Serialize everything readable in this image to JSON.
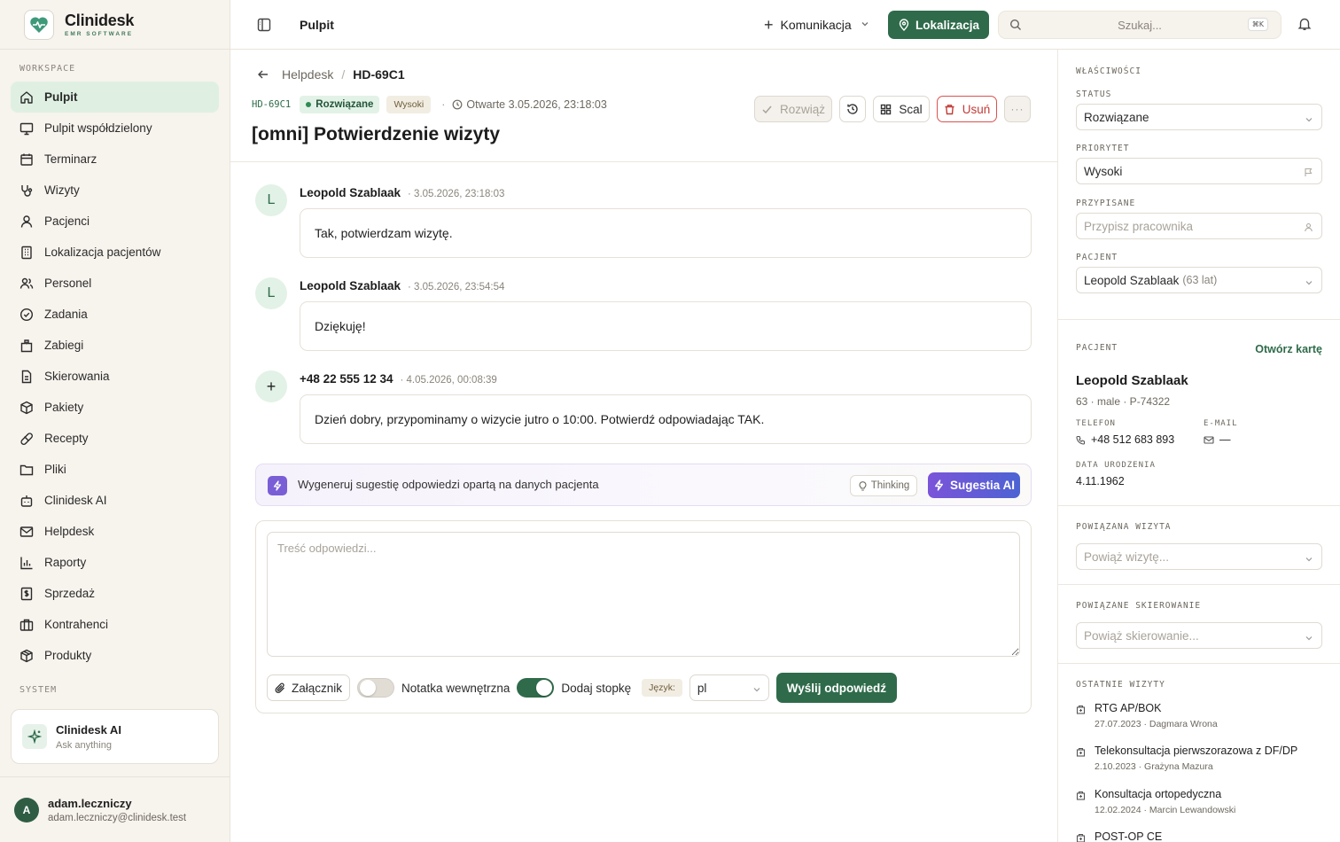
{
  "brand": {
    "name": "Clinidesk",
    "subtitle": "EMR SOFTWARE"
  },
  "sidebar": {
    "workspace_label": "WORKSPACE",
    "system_label": "SYSTEM",
    "items": [
      {
        "label": "Pulpit",
        "icon": "home-icon",
        "active": true
      },
      {
        "label": "Pulpit współdzielony",
        "icon": "monitor-icon"
      },
      {
        "label": "Terminarz",
        "icon": "calendar-icon"
      },
      {
        "label": "Wizyty",
        "icon": "stethoscope-icon"
      },
      {
        "label": "Pacjenci",
        "icon": "user-icon"
      },
      {
        "label": "Lokalizacja pacjentów",
        "icon": "building-icon"
      },
      {
        "label": "Personel",
        "icon": "users-icon"
      },
      {
        "label": "Zadania",
        "icon": "check-circle-icon"
      },
      {
        "label": "Zabiegi",
        "icon": "hospital-icon"
      },
      {
        "label": "Skierowania",
        "icon": "document-icon"
      },
      {
        "label": "Pakiety",
        "icon": "package-icon"
      },
      {
        "label": "Recepty",
        "icon": "pill-icon"
      },
      {
        "label": "Pliki",
        "icon": "folder-icon"
      },
      {
        "label": "Clinidesk AI",
        "icon": "bot-icon"
      },
      {
        "label": "Helpdesk",
        "icon": "mail-icon"
      },
      {
        "label": "Raporty",
        "icon": "bar-chart-icon"
      },
      {
        "label": "Sprzedaż",
        "icon": "receipt-icon"
      },
      {
        "label": "Kontrahenci",
        "icon": "briefcase-icon"
      },
      {
        "label": "Produkty",
        "icon": "box-icon"
      }
    ],
    "ai_card": {
      "title": "Clinidesk AI",
      "subtitle": "Ask anything"
    },
    "user": {
      "initial": "A",
      "name": "adam.leczniczy",
      "email": "adam.leczniczy@clinidesk.test"
    }
  },
  "topbar": {
    "title": "Pulpit",
    "komunikacja": "Komunikacja",
    "lokalizacja": "Lokalizacja",
    "search_placeholder": "Szukaj...",
    "search_shortcut": "⌘K"
  },
  "ticket": {
    "breadcrumb_parent": "Helpdesk",
    "breadcrumb_sep": "/",
    "breadcrumb_current": "HD-69C1",
    "id": "HD-69C1",
    "status": "Rozwiązane",
    "priority": "Wysoki",
    "meta_sep": "·",
    "opened": "Otwarte 3.05.2026, 23:18:03",
    "title": "[omni] Potwierdzenie wizyty",
    "actions": {
      "resolve": "Rozwiąż",
      "merge": "Scal",
      "delete": "Usuń",
      "more": "···"
    }
  },
  "messages": [
    {
      "initial": "L",
      "author": "Leopold Szablaak",
      "time": "· 3.05.2026, 23:18:03",
      "text": "Tak, potwierdzam wizytę."
    },
    {
      "initial": "L",
      "author": "Leopold Szablaak",
      "time": "· 3.05.2026, 23:54:54",
      "text": "Dziękuję!"
    },
    {
      "initial": "+",
      "author": "+48 22 555 12 34",
      "time": "· 4.05.2026, 00:08:39",
      "text": "Dzień dobry, przypominamy o wizycie jutro o 10:00. Potwierdź odpowiadając TAK."
    }
  ],
  "ai_suggest": {
    "text": "Wygeneruj sugestię odpowiedzi opartą na danych pacjenta",
    "thinking": "Thinking",
    "button": "Sugestia AI"
  },
  "composer": {
    "placeholder": "Treść odpowiedzi...",
    "attach": "Załącznik",
    "internal_note": "Notatka wewnętrzna",
    "internal_note_on": false,
    "footer": "Dodaj stopkę",
    "footer_on": true,
    "lang_label": "Język:",
    "lang_value": "pl",
    "send": "Wyślij odpowiedź"
  },
  "properties": {
    "title": "WŁAŚCIWOŚCI",
    "status_label": "STATUS",
    "status_value": "Rozwiązane",
    "priority_label": "PRIORYTET",
    "priority_value": "Wysoki",
    "assigned_label": "PRZYPISANE",
    "assigned_placeholder": "Przypisz pracownika",
    "patient_label": "PACJENT",
    "patient_value": "Leopold Szablaak",
    "patient_age": "(63 lat)"
  },
  "patient_card": {
    "label": "PACJENT",
    "open_card": "Otwórz kartę",
    "name": "Leopold Szablaak",
    "meta": "63 · male · P-74322",
    "phone_label": "TELEFON",
    "phone": "+48 512 683 893",
    "email_label": "E-MAIL",
    "email": "—",
    "dob_label": "DATA URODZENIA",
    "dob": "4.11.1962"
  },
  "related_visit": {
    "label": "POWIĄZANA WIZYTA",
    "placeholder": "Powiąż wizytę..."
  },
  "related_referral": {
    "label": "POWIĄZANE SKIEROWANIE",
    "placeholder": "Powiąż skierowanie..."
  },
  "recent_visits": {
    "label": "OSTATNIE WIZYTY",
    "items": [
      {
        "name": "RTG AP/BOK",
        "meta": "27.07.2023 · Dagmara Wrona"
      },
      {
        "name": "Telekonsultacja pierwszorazowa z DF/DP",
        "meta": "2.10.2023 · Grażyna Mazura"
      },
      {
        "name": "Konsultacja ortopedyczna",
        "meta": "12.02.2024 · Marcin Lewandowski"
      },
      {
        "name": "POST-OP CE",
        "meta": ""
      }
    ]
  },
  "colors": {
    "accent": "#2f6b4a",
    "sidebar_bg": "#f7f3ed",
    "active_bg": "#dff0e3",
    "danger": "#c13a36",
    "ai_gradient_start": "#7b54d9",
    "ai_gradient_end": "#4d63d3"
  }
}
